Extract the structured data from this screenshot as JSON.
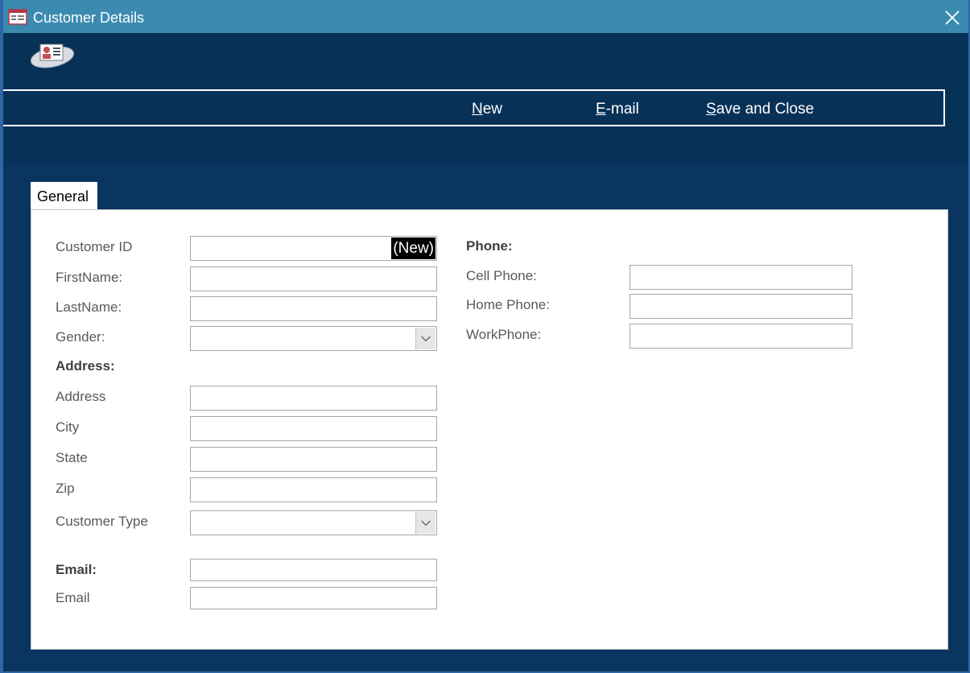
{
  "window": {
    "title": "Customer Details"
  },
  "commands": {
    "new_label": "ew",
    "new_accel": "N",
    "email_label": "-mail",
    "email_accel": "E",
    "save_label": "ave and Close",
    "save_accel": "S"
  },
  "tabs": [
    {
      "label": "General"
    }
  ],
  "form": {
    "customer_id": {
      "label": "Customer ID",
      "value": "(New)"
    },
    "first_name": {
      "label": "FirstName:",
      "value": ""
    },
    "last_name": {
      "label": "LastName:",
      "value": ""
    },
    "gender": {
      "label": "Gender:",
      "value": ""
    },
    "address_section": "Address:",
    "address": {
      "label": "Address",
      "value": ""
    },
    "city": {
      "label": "City",
      "value": ""
    },
    "state": {
      "label": "State",
      "value": ""
    },
    "zip": {
      "label": "Zip",
      "value": ""
    },
    "customer_type": {
      "label": "Customer Type",
      "value": ""
    },
    "email_section": "Email:",
    "email_section_value": "",
    "email": {
      "label": "Email",
      "value": ""
    },
    "phone_section": "Phone:",
    "cell_phone": {
      "label": "Cell Phone:",
      "value": ""
    },
    "home_phone": {
      "label": "Home Phone:",
      "value": ""
    },
    "work_phone": {
      "label": "WorkPhone:",
      "value": ""
    }
  },
  "colors": {
    "titlebar": "#3b8bb0",
    "background": "#0a3561",
    "header": "#083158",
    "panel": "#ffffff"
  },
  "icons": {
    "title": "form-icon",
    "logo": "contact-card-icon",
    "close": "close-icon",
    "dropdown": "chevron-down-icon"
  }
}
